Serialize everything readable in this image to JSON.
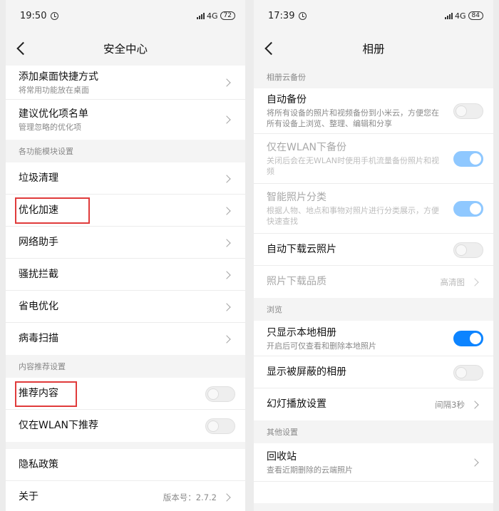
{
  "left": {
    "status": {
      "time": "19:50",
      "network": "4G",
      "battery": "72"
    },
    "title": "安全中心",
    "top_items": [
      {
        "label": "添加桌面快捷方式",
        "sub": "将常用功能放在桌面"
      },
      {
        "label": "建议优化项名单",
        "sub": "管理忽略的优化项"
      }
    ],
    "section_modules": "各功能模块设置",
    "module_items": [
      {
        "label": "垃圾清理"
      },
      {
        "label": "优化加速"
      },
      {
        "label": "网络助手"
      },
      {
        "label": "骚扰拦截"
      },
      {
        "label": "省电优化"
      },
      {
        "label": "病毒扫描"
      }
    ],
    "section_content": "内容推荐设置",
    "content_items": [
      {
        "label": "推荐内容",
        "toggle": false
      },
      {
        "label": "仅在WLAN下推荐",
        "toggle": false
      }
    ],
    "other_items": [
      {
        "label": "隐私政策"
      },
      {
        "label": "关于",
        "value": "版本号：2.7.2"
      }
    ],
    "highlight_color": "#e03b3b"
  },
  "right": {
    "status": {
      "time": "17:39",
      "network": "4G",
      "battery": "84"
    },
    "title": "相册",
    "section_cloud": "相册云备份",
    "cloud_items": [
      {
        "label": "自动备份",
        "sub": "将所有设备的照片和视频备份到小米云，方便您在所有设备上浏览、整理、编辑和分享",
        "toggle": "off"
      },
      {
        "label": "仅在WLAN下备份",
        "sub": "关闭后会在无WLAN时使用手机流量备份照片和视频",
        "toggle": "on-dim",
        "disabled": true
      },
      {
        "label": "智能照片分类",
        "sub": "根据人物、地点和事物对照片进行分类展示，方便快速查找",
        "toggle": "on-dim",
        "disabled": true
      },
      {
        "label": "自动下载云照片",
        "toggle": "off"
      },
      {
        "label": "照片下载品质",
        "value": "高清图",
        "disabled": true
      }
    ],
    "section_browse": "浏览",
    "browse_items": [
      {
        "label": "只显示本地相册",
        "sub": "开启后可仅查看和删除本地照片",
        "toggle": "on"
      },
      {
        "label": "显示被屏蔽的相册",
        "toggle": "off"
      },
      {
        "label": "幻灯播放设置",
        "value": "间隔3秒"
      }
    ],
    "section_other": "其他设置",
    "other_items": [
      {
        "label": "回收站",
        "sub": "查看近期删除的云端照片"
      }
    ],
    "accent_color": "#0d84ff"
  }
}
